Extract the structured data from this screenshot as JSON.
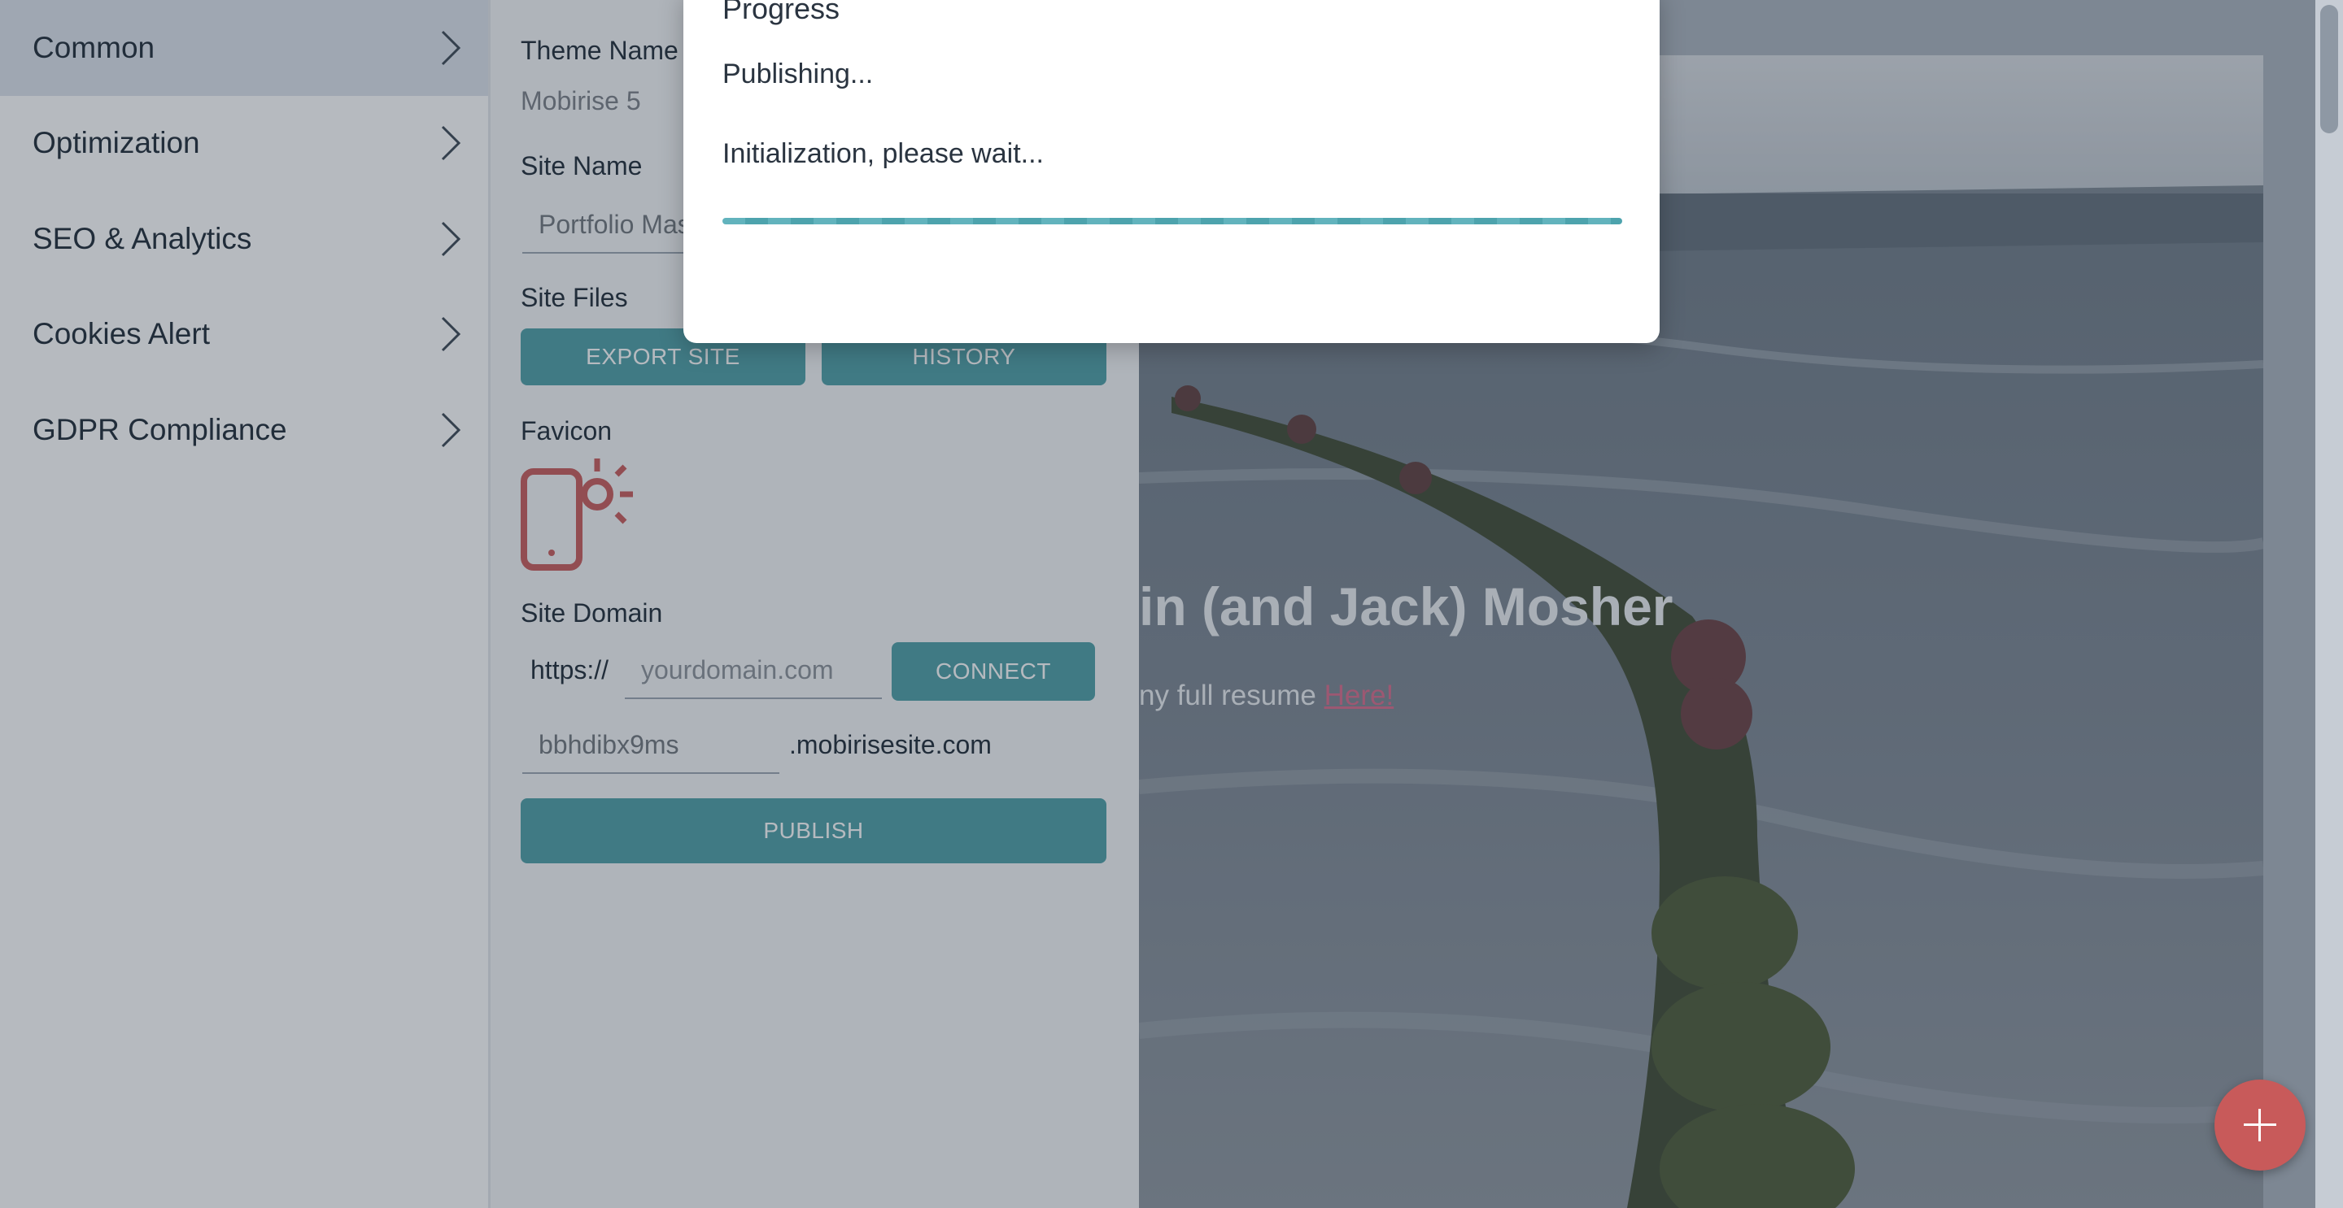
{
  "menu": {
    "items": [
      {
        "label": "Common",
        "active": true
      },
      {
        "label": "Optimization"
      },
      {
        "label": "SEO & Analytics"
      },
      {
        "label": "Cookies Alert"
      },
      {
        "label": "GDPR Compliance"
      }
    ]
  },
  "settings": {
    "theme_name_label": "Theme Name",
    "theme_name_value": "Mobirise 5",
    "site_name_label": "Site Name",
    "site_name_value": "Portfolio Mast",
    "site_files_label": "Site Files",
    "export_label": "EXPORT SITE",
    "history_label": "HISTORY",
    "favicon_label": "Favicon",
    "site_domain_label": "Site Domain",
    "https_prefix": "https://",
    "domain_placeholder": "yourdomain.com",
    "connect_label": "CONNECT",
    "subdomain_value": "bbhdibx9ms",
    "subdomain_suffix": ".mobirisesite.com",
    "publish_label": "PUBLISH"
  },
  "preview": {
    "hero_title": "in (and Jack) Mosher",
    "hero_sub_prefix": "ny full resume ",
    "hero_sub_link": "Here!"
  },
  "dialog": {
    "title": "Progress",
    "status": "Publishing...",
    "message": "Initialization, please wait..."
  },
  "colors": {
    "accent": "#4d9ea6",
    "fab": "#c85a5a",
    "favicon": "#c85a5a"
  },
  "icons": {
    "menu_chevron": "chevron-right-icon",
    "favicon": "phone-sun-icon",
    "fab": "plus-icon"
  }
}
